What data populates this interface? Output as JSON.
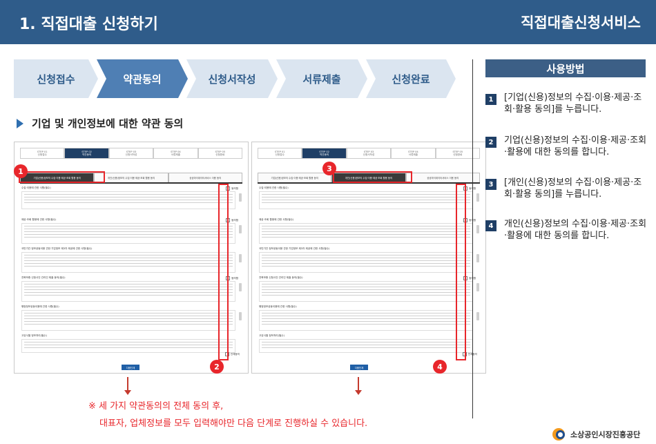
{
  "header": {
    "title": "1. 직접대출 신청하기",
    "service": "직접대출신청서비스"
  },
  "steps": [
    {
      "label": "신청접수",
      "active": false
    },
    {
      "label": "약관동의",
      "active": true
    },
    {
      "label": "신청서작성",
      "active": false
    },
    {
      "label": "서류제출",
      "active": false
    },
    {
      "label": "신청완료",
      "active": false
    }
  ],
  "section_title": "기업 및 개인정보에 대한 약관 동의",
  "panels": [
    {
      "mini_steps": [
        {
          "n": "STEP 01",
          "label": "신청접수"
        },
        {
          "n": "STEP 02",
          "label": "약관동의"
        },
        {
          "n": "STEP 03",
          "label": "신청서작성"
        },
        {
          "n": "STEP 04",
          "label": "서류제출"
        },
        {
          "n": "STEP 05",
          "label": "신청완료"
        }
      ],
      "tabs": [
        "기업(신용)정보의 수집·이용·제공·조회 활용 동의",
        "개인(신용)정보의 수집·이용·제공·조회 활용 동의",
        "공공마이데이터서비스 이용 동의"
      ],
      "active_tab": 0,
      "blocks": [
        "수집·이용에 관한 사항(필수)",
        "제공·조회 활용에 관한 사항(필수)",
        "국민기관 정보공동이용 관한 기업정보 제3자 제공에 관한 사항(필수)",
        "전북보증 신청사건 관리인 제출 동의(필수)",
        "행정정보공동이용에 관한 사항(필수)",
        "고유식별 정보처리(필수)"
      ],
      "agree_label": "동의함",
      "total_agree": "전체동의",
      "next_label": "다음단계"
    },
    {
      "mini_steps": [
        {
          "n": "STEP 01",
          "label": "신청접수"
        },
        {
          "n": "STEP 02",
          "label": "약관동의"
        },
        {
          "n": "STEP 03",
          "label": "신청서작성"
        },
        {
          "n": "STEP 04",
          "label": "서류제출"
        },
        {
          "n": "STEP 05",
          "label": "신청완료"
        }
      ],
      "tabs": [
        "기업(신용)정보의 수집·이용·제공·조회 활용 동의",
        "개인(신용)정보의 수집·이용·제공·조회 활용 동의",
        "공공마이데이터서비스 이용 동의"
      ],
      "active_tab": 1,
      "blocks": [
        "수집·이용에 관한 사항(필수)",
        "제공·조회 활용에 관한 사항(필수)",
        "국민기관 정보공동이용 관한 기업정보 제3자 제공에 관한 사항(필수)",
        "전북보증 신청사건 관리인 제출 동의(필수)",
        "행정정보공동이용에 관한 사항(필수)",
        "고유식별 정보처리(필수)"
      ],
      "agree_label": "동의함",
      "total_agree": "전체동의",
      "next_label": "다음단계"
    }
  ],
  "badges": [
    "1",
    "2",
    "3",
    "4"
  ],
  "notes": {
    "line1": "※ 세 가지 약관동의의 전체 동의 후,",
    "line2": "대표자, 업체정보를 모두 입력해야만 다음 단계로 진행하실 수 있습니다."
  },
  "usage": {
    "header": "사용방법",
    "items": [
      {
        "num": "1",
        "text": "[기업(신용)정보의 수집·이용·제공·조회·활용 동의]를 누릅니다."
      },
      {
        "num": "2",
        "text": "기업(신용)정보의 수집·이용·제공·조회·활용에 대한 동의를 합니다."
      },
      {
        "num": "3",
        "text": "[개인(신용)정보의 수집·이용·제공·조회·활용 동의]를 누릅니다."
      },
      {
        "num": "4",
        "text": "개인(신용)정보의 수집·이용·제공·조회·활용에 대한 동의를 합니다."
      }
    ]
  },
  "logo": {
    "text": "소상공인시장진흥공단"
  },
  "colors": {
    "header_bg": "#2f5c8a",
    "step_active": "#4f7fb4",
    "step_inactive": "#dbe5f0",
    "annotation_red": "#e8262b",
    "usage_header": "#3c5f86"
  }
}
